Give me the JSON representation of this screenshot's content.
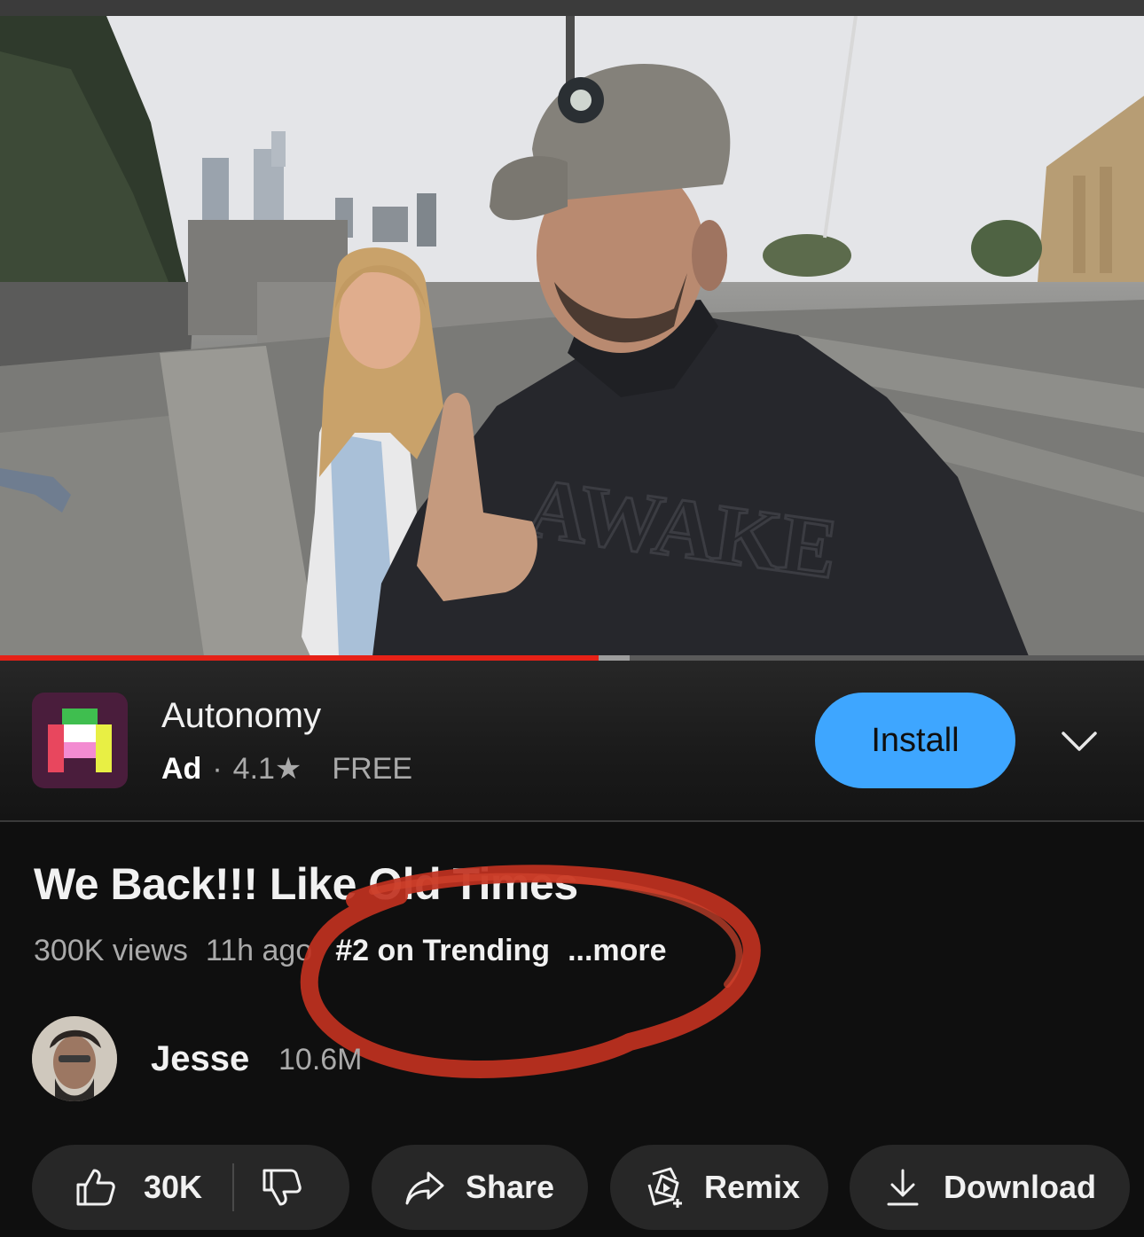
{
  "video": {
    "progress_fraction": 0.523,
    "buffered_fraction": 0.55,
    "hoodie_print": "AWAKE"
  },
  "ad": {
    "app_name": "Autonomy",
    "badge": "Ad",
    "separator": "·",
    "rating": "4.1",
    "star": "★",
    "price": "FREE",
    "install_label": "Install",
    "colors": {
      "install_bg": "#3ea6ff",
      "logo_bg": "#4a1d3c"
    }
  },
  "video_info": {
    "title": "We Back!!! Like Old Times",
    "views": "300K views",
    "age": "11h ago",
    "trending": "#2 on Trending",
    "more_label": "...more"
  },
  "channel": {
    "name": "Jesse",
    "subscribers": "10.6M"
  },
  "actions": {
    "like_count": "30K",
    "share_label": "Share",
    "remix_label": "Remix",
    "download_label": "Download"
  },
  "icons": [
    "thumbs-up-icon",
    "thumbs-down-icon",
    "share-arrow-icon",
    "remix-icon",
    "download-icon",
    "chevron-down-icon"
  ],
  "colors": {
    "background": "#0f0f0f",
    "progress": "#e62117",
    "annotation": "#c0311f"
  }
}
